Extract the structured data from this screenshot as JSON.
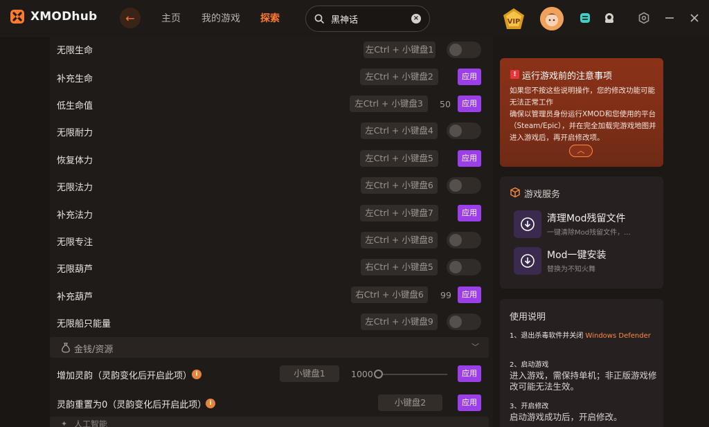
{
  "app": {
    "name": "XMODhub"
  },
  "nav": {
    "home": "主页",
    "my_games": "我的游戏",
    "explore": "探索"
  },
  "search": {
    "value": "黑神话"
  },
  "colors": {
    "accent": "#ff7a2f",
    "apply": "#9b40e8",
    "notice": "#8a3218"
  },
  "cheats": [
    {
      "label": "无限生命",
      "key": "左Ctrl + 小键盘1",
      "control": "toggle"
    },
    {
      "label": "补充生命",
      "key": "左Ctrl + 小键盘2",
      "control": "apply",
      "apply_label": "应用"
    },
    {
      "label": "低生命值",
      "key": "左Ctrl + 小键盘3",
      "value": "50",
      "control": "apply",
      "apply_label": "应用"
    },
    {
      "label": "无限耐力",
      "key": "左Ctrl + 小键盘4",
      "control": "toggle"
    },
    {
      "label": "恢复体力",
      "key": "左Ctrl + 小键盘5",
      "control": "apply",
      "apply_label": "应用"
    },
    {
      "label": "无限法力",
      "key": "左Ctrl + 小键盘6",
      "control": "toggle"
    },
    {
      "label": "补充法力",
      "key": "左Ctrl + 小键盘7",
      "control": "apply",
      "apply_label": "应用"
    },
    {
      "label": "无限专注",
      "key": "左Ctrl + 小键盘8",
      "control": "toggle"
    },
    {
      "label": "无限葫芦",
      "key": "右Ctrl + 小键盘5",
      "control": "toggle"
    },
    {
      "label": "补充葫芦",
      "key": "右Ctrl + 小键盘6",
      "value": "99",
      "control": "apply",
      "apply_label": "应用"
    },
    {
      "label": "无限船只能量",
      "key": "左Ctrl + 小键盘9",
      "control": "toggle"
    }
  ],
  "section_money": {
    "label": "金钱/资源"
  },
  "money_rows": [
    {
      "label": "增加灵韵（灵韵变化后开启此项）",
      "key": "小键盘1",
      "value": "1000",
      "apply_label": "应用",
      "info": "i"
    },
    {
      "label": "灵韵重置为0（灵韵变化后开启此项）",
      "key": "小键盘2",
      "apply_label": "应用",
      "info": "i"
    }
  ],
  "section_next": {
    "label": "人工智能"
  },
  "notice": {
    "title": "运行游戏前的注意事项",
    "warn_icon": "!",
    "line1": "如果您不按这些说明操作，您的修改功能可能无法正常工作",
    "line2": "确保以管理员身份运行XMOD和您使用的平台（Steam/Epic），并在完全加载完游戏地图并进入游戏后，再开启修改项。",
    "collapse": "︿"
  },
  "service": {
    "title": "游戏服务",
    "items": [
      {
        "name": "清理Mod残留文件",
        "desc": "一键清除Mod残留文件，..."
      },
      {
        "name": "Mod一键安装",
        "desc": "替换为不知火舞"
      }
    ]
  },
  "usage": {
    "title": "使用说明",
    "step1_prefix": "1、退出杀毒软件并关闭 ",
    "step1_highlight": "Windows Defender",
    "step2_title": "2、启动游戏",
    "step2_body": "进入游戏，需保持单机；非正版游戏修改可能无法生效。",
    "step3_title": "3、开启修改",
    "step3_body": "启动游戏成功后，开启修改。"
  }
}
